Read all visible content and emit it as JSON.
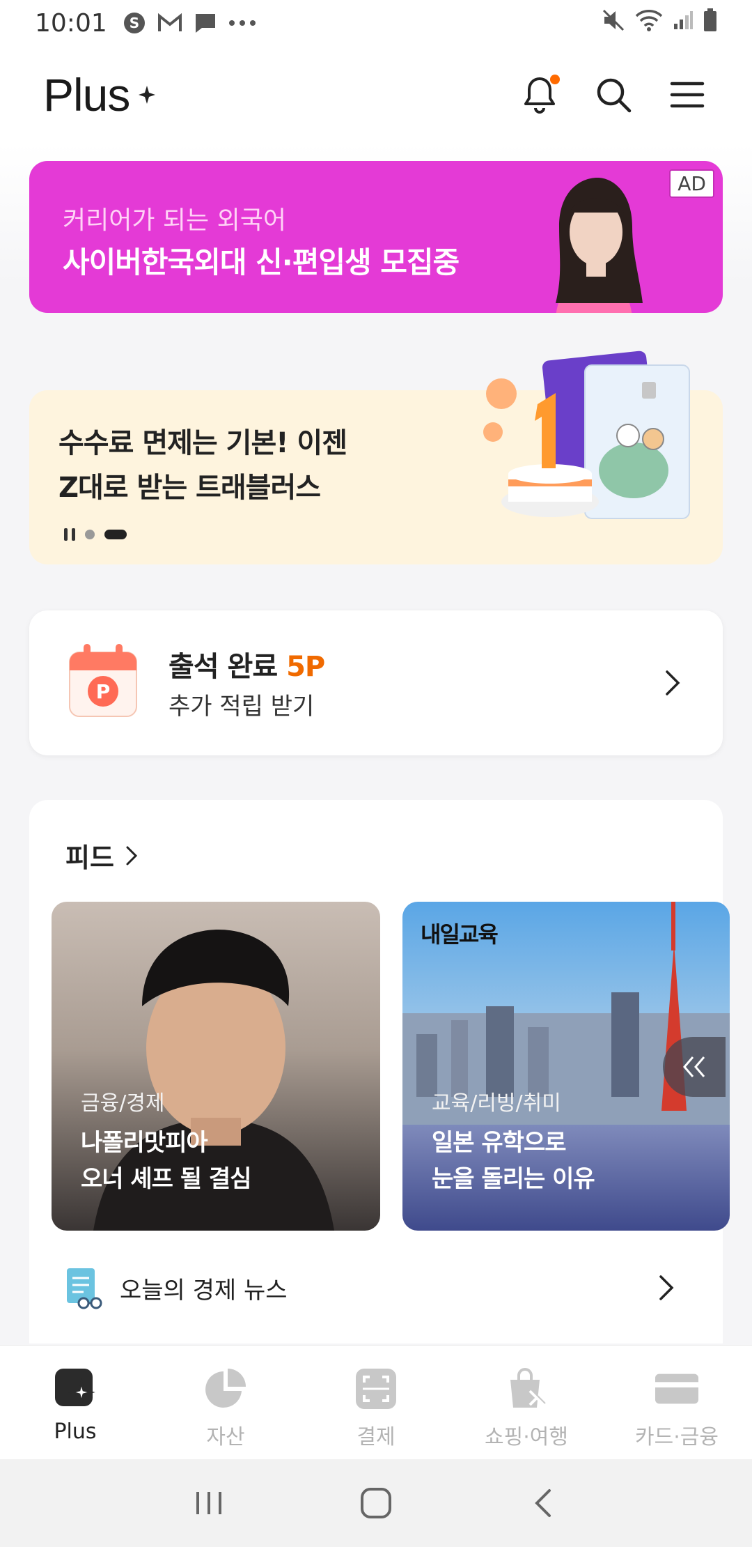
{
  "status_bar": {
    "time": "10:01",
    "left_icons": [
      "s-app-icon",
      "gmail-icon",
      "message-icon",
      "more-dots-icon"
    ],
    "right_icons": [
      "mute-icon",
      "wifi-icon",
      "signal-icon",
      "battery-icon"
    ]
  },
  "header": {
    "logo": "Plus",
    "has_notification": true,
    "accent_color": "#ff6a00"
  },
  "ad": {
    "subtitle": "커리어가 되는 외국어",
    "title": "사이버한국외대 신·편입생 모집중",
    "badge": "AD",
    "bg_color": "#e43ad6"
  },
  "promo": {
    "line1": "수수료 면제는 기본! 이젠",
    "line2": "Z대로 받는 트래블러스",
    "bg_color": "#fef4de"
  },
  "attendance": {
    "title": "출석 완료",
    "points": "5P",
    "subtitle": "추가 적립 받기",
    "points_color": "#f06a00"
  },
  "feed": {
    "title": "피드",
    "items": [
      {
        "category": "금융/경제",
        "headline_line1": "나폴리맛피아",
        "headline_line2": "오너 셰프 될 결심"
      },
      {
        "brand": "내일교육",
        "category": "교육/리빙/취미",
        "headline_line1": "일본 유학으로",
        "headline_line2": "눈을 돌리는 이유"
      }
    ],
    "news_label": "오늘의 경제 뉴스"
  },
  "bottom_nav": {
    "items": [
      {
        "label": "Plus",
        "icon": "plus-star-icon",
        "active": true
      },
      {
        "label": "자산",
        "icon": "pie-chart-icon",
        "active": false
      },
      {
        "label": "결제",
        "icon": "scan-icon",
        "active": false
      },
      {
        "label": "쇼핑·여행",
        "icon": "shopping-bag-icon",
        "active": false
      },
      {
        "label": "카드·금융",
        "icon": "card-icon",
        "active": false
      }
    ]
  }
}
